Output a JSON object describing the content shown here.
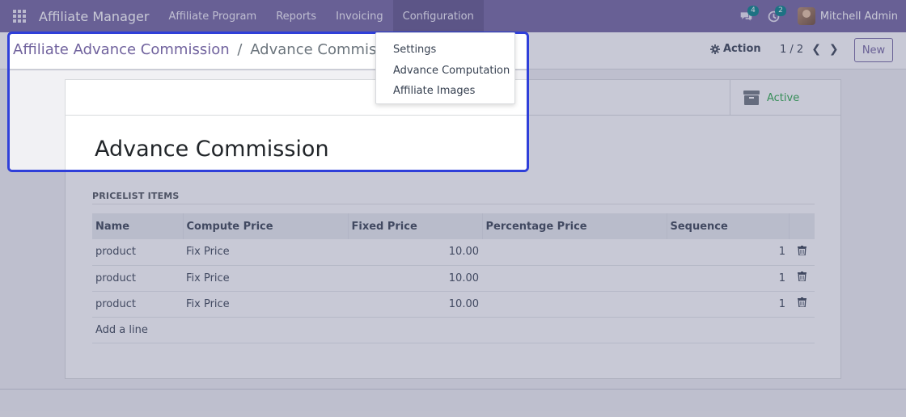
{
  "navbar": {
    "brand": "Affiliate Manager",
    "menu": [
      {
        "label": "Affiliate Program"
      },
      {
        "label": "Reports"
      },
      {
        "label": "Invoicing"
      },
      {
        "label": "Configuration"
      }
    ],
    "messages_count": "4",
    "activities_count": "2",
    "user_name": "Mitchell Admin"
  },
  "control": {
    "breadcrumb_parent": "Affiliate Advance Commission",
    "breadcrumb_separator": "/",
    "breadcrumb_current": "Advance Commission",
    "action_label": "Action",
    "pager": "1 / 2",
    "new_label": "New"
  },
  "form": {
    "active_label": "Active",
    "title": "Advance Commission",
    "section_title": "PRICELIST ITEMS",
    "columns": [
      "Name",
      "Compute Price",
      "Fixed Price",
      "Percentage Price",
      "Sequence"
    ],
    "rows": [
      {
        "name": "product",
        "compute_price": "Fix Price",
        "fixed_price": "10.00",
        "percentage_price": "",
        "sequence": "1"
      },
      {
        "name": "product",
        "compute_price": "Fix Price",
        "fixed_price": "10.00",
        "percentage_price": "",
        "sequence": "1"
      },
      {
        "name": "product",
        "compute_price": "Fix Price",
        "fixed_price": "10.00",
        "percentage_price": "",
        "sequence": "1"
      }
    ],
    "add_line": "Add a line"
  },
  "dropdown": {
    "items": [
      {
        "label": "Settings"
      },
      {
        "label": "Advance Computation"
      },
      {
        "label": "Affiliate Images"
      }
    ]
  },
  "colors": {
    "navbar": "#71639e",
    "accent": "#71639e",
    "active": "#28a745",
    "highlight": "#2f3fd9",
    "badge": "#017e84"
  }
}
